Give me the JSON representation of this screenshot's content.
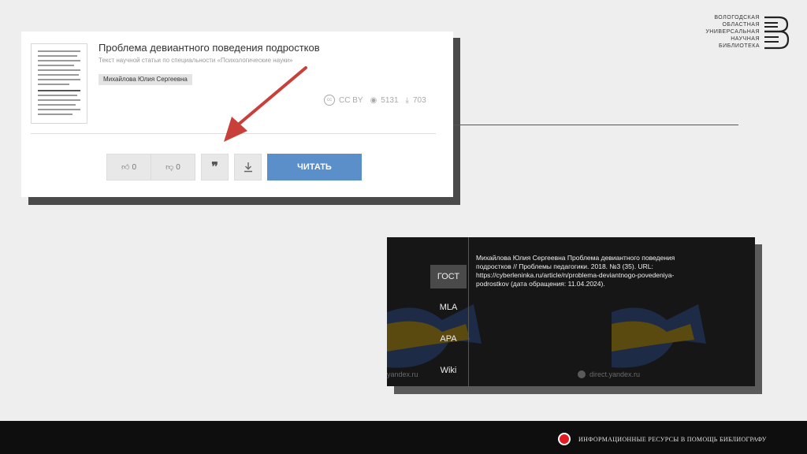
{
  "card": {
    "title": "Проблема девиантного поведения подростков",
    "subtitle": "Текст научной статьи по специальности «Психологические науки»",
    "author": "Михайлова Юлия Сергеевна",
    "license": "CC BY",
    "views": "5131",
    "downloads": "703",
    "like_count": "0",
    "dislike_count": "0",
    "cite_glyph": "❞",
    "read_label": "ЧИТАТЬ"
  },
  "logo": {
    "lines": [
      "ВОЛОГОДСКАЯ",
      "ОБЛАСТНАЯ",
      "УНИВЕРСАЛЬНАЯ",
      "НАУЧНАЯ",
      "БИБЛИОТЕКА"
    ]
  },
  "citation": {
    "tabs": [
      "ГОСТ",
      "MLA",
      "APA",
      "Wiki"
    ],
    "active_tab": "ГОСТ",
    "text": "Михайлова Юлия Сергеевна Проблема девиантного поведения подростков // Проблемы педагогики. 2018. №3 (35). URL: https://cyberleninka.ru/article/n/problema-deviantnogo-povedeniya-podrostkov (дата обращения: 11.04.2024).",
    "bg_label_left": "yandex.ru",
    "bg_label_right": "direct.yandex.ru"
  },
  "footer": {
    "text": "ИНФОРМАЦИОННЫЕ РЕСУРСЫ В ПОМОЩЬ БИБЛИОГРАФУ"
  },
  "colors": {
    "read_button": "#5b8fc9",
    "arrow": "#c9403a",
    "footer_dot": "#e11b22",
    "panel_bg": "#161616"
  }
}
